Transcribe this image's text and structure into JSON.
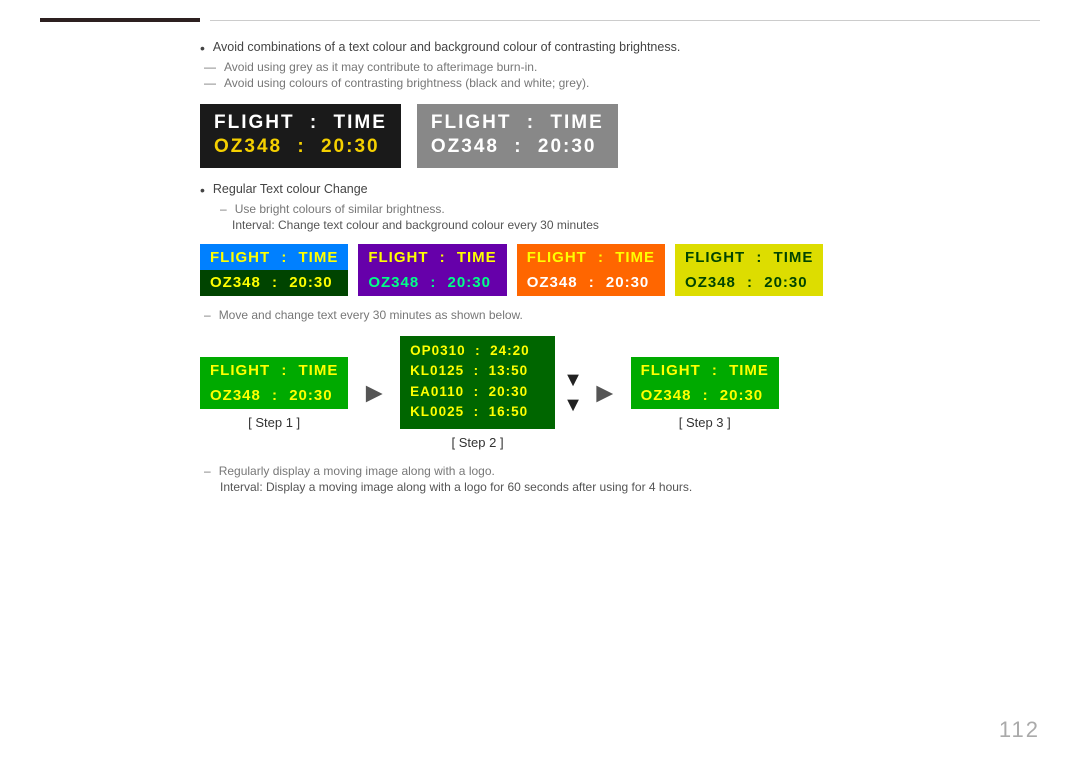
{
  "page": {
    "number": "112"
  },
  "topBar": {
    "darkWidth": "160px"
  },
  "bullets": {
    "item1": "Avoid combinations of a text colour and background colour of contrasting brightness.",
    "dash1": "Avoid using grey as it may contribute to afterimage burn-in.",
    "dash2": "Avoid using colours of contrasting brightness (black and white; grey)."
  },
  "display1": {
    "header": [
      "FLIGHT",
      ":",
      "TIME"
    ],
    "data": [
      "OZ348",
      ":",
      "20:30"
    ],
    "bg": "#1a1a1a",
    "headerColor": "#ffffff",
    "dataColor": "#f5d000"
  },
  "display2": {
    "header": [
      "FLIGHT",
      ":",
      "TIME"
    ],
    "data": [
      "OZ348",
      ":",
      "20:30"
    ],
    "bg": "#888888",
    "headerColor": "#ffffff",
    "dataColor": "#ffffff"
  },
  "bullets2": {
    "item1": "Regular Text colour Change",
    "dash1": "Use bright colours of similar brightness.",
    "dash2": "Interval: Change text colour and background colour every 30 minutes"
  },
  "variants": [
    {
      "id": "blue",
      "topBg": "#0088ff",
      "bottomBg": "#004400",
      "headerColor": "#ffff00",
      "dataColor": "#ffff00",
      "header": [
        "FLIGHT",
        ":",
        "TIME"
      ],
      "data": [
        "OZ348",
        ":",
        "20:30"
      ]
    },
    {
      "id": "purple",
      "topBg": "#660099",
      "bottomBg": "#660099",
      "headerColor": "#ffff00",
      "dataColor": "#00ff88",
      "header": [
        "FLIGHT",
        ":",
        "TIME"
      ],
      "data": [
        "OZ348",
        ":",
        "20:30"
      ]
    },
    {
      "id": "orange",
      "topBg": "#ff6600",
      "bottomBg": "#ff6600",
      "headerColor": "#ffff00",
      "dataColor": "#ffffff",
      "header": [
        "FLIGHT",
        ":",
        "TIME"
      ],
      "data": [
        "OZ348",
        ":",
        "20:30"
      ]
    },
    {
      "id": "yellow",
      "topBg": "#dddd00",
      "bottomBg": "#dddd00",
      "headerColor": "#004400",
      "dataColor": "#004400",
      "header": [
        "FLIGHT",
        ":",
        "TIME"
      ],
      "data": [
        "OZ348",
        ":",
        "20:30"
      ]
    }
  ],
  "stepDash": "Move and change text every 30 minutes as shown below.",
  "steps": {
    "step1": {
      "label": "[ Step 1 ]",
      "topBg": "#00aa00",
      "bottomBg": "#00aa00",
      "headerColor": "#ffff00",
      "dataColor": "#ffff00",
      "header": [
        "FLIGHT",
        ":",
        "TIME"
      ],
      "data": [
        "OZ348",
        ":",
        "20:30"
      ]
    },
    "step2": {
      "label": "[ Step 2 ]",
      "bg": "#006600",
      "textColor": "#ffff00",
      "rows": [
        "OP0310  :  24:20",
        "KL0125  :  13:50",
        "EA0110  :  20:30",
        "KL0025  :  16:50"
      ]
    },
    "step3": {
      "label": "[ Step 3 ]",
      "topBg": "#00aa00",
      "bottomBg": "#00aa00",
      "headerColor": "#ffff00",
      "dataColor": "#ffff00",
      "header": [
        "FLIGHT",
        ":",
        "TIME"
      ],
      "data": [
        "OZ348",
        ":",
        "20:30"
      ]
    }
  },
  "footnotes": {
    "dash1": "Regularly display a moving image along with a logo.",
    "dash2": "Interval: Display a moving image along with a logo for 60 seconds after using for 4 hours."
  }
}
